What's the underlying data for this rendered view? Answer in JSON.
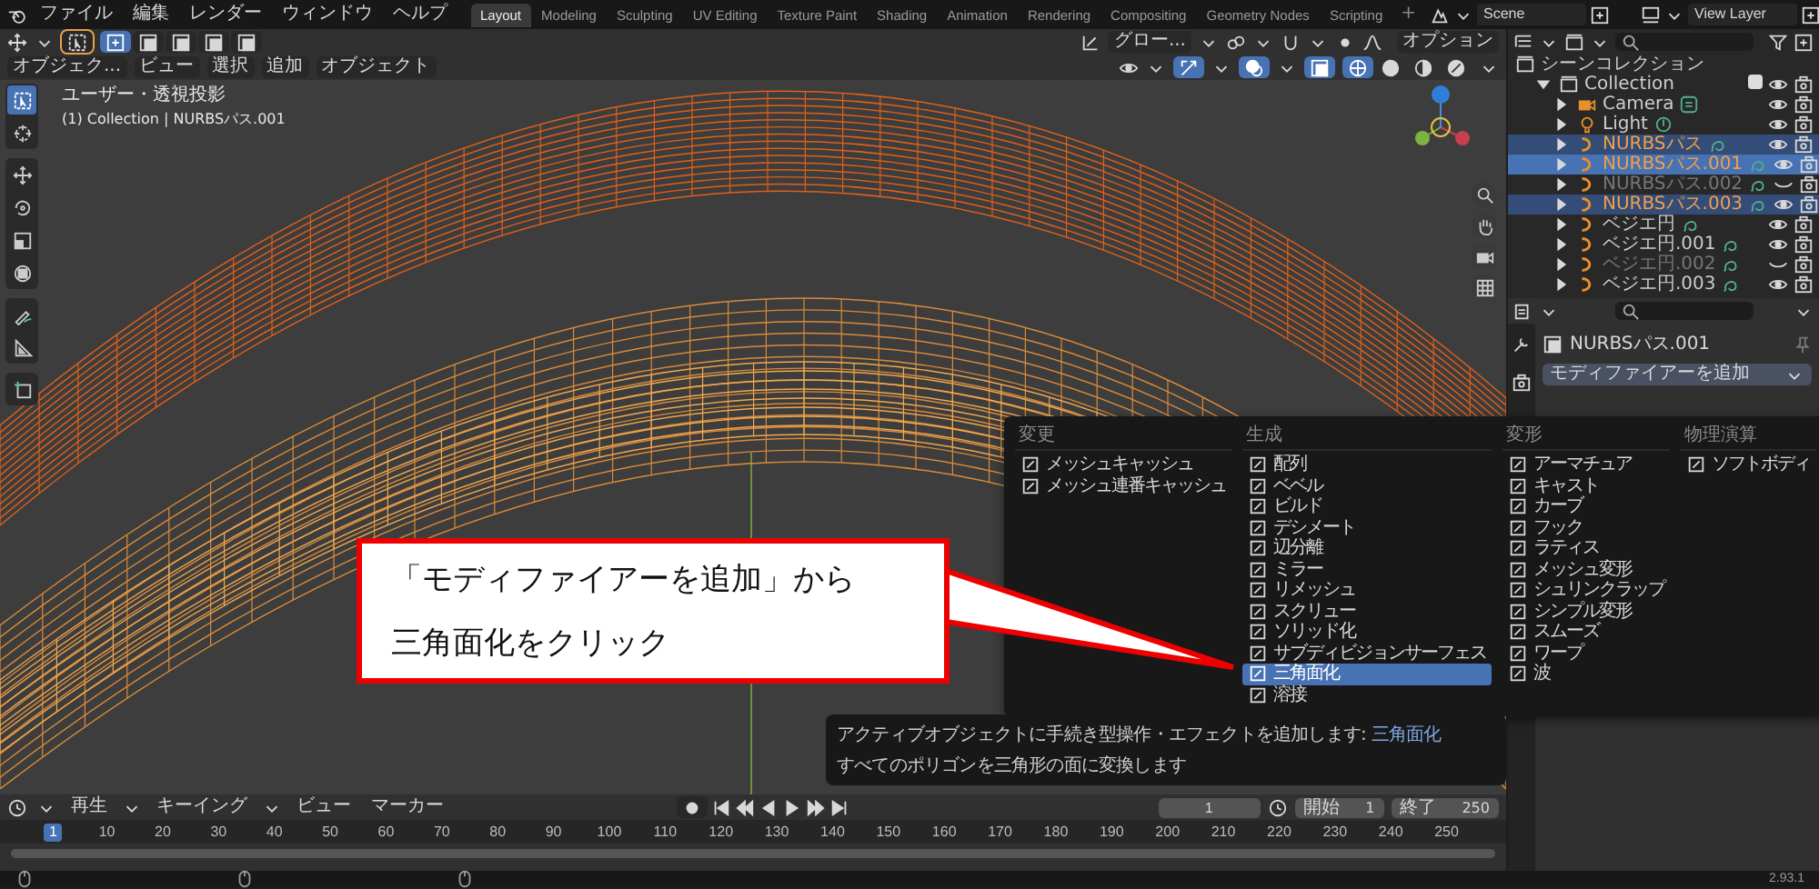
{
  "top_menu": [
    "ファイル",
    "編集",
    "レンダー",
    "ウィンドウ",
    "ヘルプ"
  ],
  "workspace_tabs": [
    {
      "label": "Layout",
      "selected": true
    },
    {
      "label": "Modeling",
      "selected": false
    },
    {
      "label": "Sculpting",
      "selected": false
    },
    {
      "label": "UV Editing",
      "selected": false
    },
    {
      "label": "Texture Paint",
      "selected": false
    },
    {
      "label": "Shading",
      "selected": false
    },
    {
      "label": "Animation",
      "selected": false
    },
    {
      "label": "Rendering",
      "selected": false
    },
    {
      "label": "Compositing",
      "selected": false
    },
    {
      "label": "Geometry Nodes",
      "selected": false
    },
    {
      "label": "Scripting",
      "selected": false
    }
  ],
  "add_workspace": "+",
  "scene": "Scene",
  "view_layer": "View Layer",
  "viewport": {
    "orientation": "グロー...",
    "options": "オプション",
    "mode": "オブジェク...",
    "menus": [
      "ビュー",
      "選択",
      "追加",
      "オブジェクト"
    ],
    "select_modes": [
      {
        "selected": true
      },
      {
        "selected": false
      },
      {
        "selected": false
      },
      {
        "selected": false
      },
      {
        "selected": false
      }
    ],
    "shading_modes": [
      {
        "kind": "wireframe",
        "selected": true
      },
      {
        "kind": "solid",
        "selected": false
      },
      {
        "kind": "material",
        "selected": false
      },
      {
        "kind": "rendered",
        "selected": false
      }
    ],
    "overlay_lines": [
      "ユーザー・透視投影",
      "(1) Collection | NURBSパス.001"
    ],
    "tools": [
      {
        "kind": "select",
        "selected": true
      },
      {
        "kind": "cursor",
        "selected": false
      },
      {
        "kind": "move",
        "selected": false
      },
      {
        "kind": "rotate",
        "selected": false
      },
      {
        "kind": "scale",
        "selected": false
      },
      {
        "kind": "transform",
        "selected": false
      },
      {
        "kind": "annotate",
        "selected": false
      },
      {
        "kind": "measure",
        "selected": false
      },
      {
        "kind": "addcube",
        "selected": false
      }
    ]
  },
  "outliner": {
    "root": "シーンコレクション",
    "children": [
      {
        "name": "Collection",
        "kind": "collection",
        "checked": true,
        "expanded": true,
        "children": [
          {
            "name": "Camera",
            "kind": "camera",
            "expanded": false,
            "selected": false,
            "active": false,
            "hidden": false
          },
          {
            "name": "Light",
            "kind": "light",
            "expanded": false,
            "selected": false,
            "active": false,
            "hidden": false
          },
          {
            "name": "NURBSパス",
            "kind": "curve",
            "expanded": false,
            "selected": true,
            "active": false,
            "hidden": false
          },
          {
            "name": "NURBSパス.001",
            "kind": "curve",
            "expanded": false,
            "selected": true,
            "active": true,
            "hidden": false
          },
          {
            "name": "NURBSパス.002",
            "kind": "curve",
            "expanded": false,
            "selected": false,
            "active": false,
            "hidden": true
          },
          {
            "name": "NURBSパス.003",
            "kind": "curve",
            "expanded": false,
            "selected": true,
            "active": false,
            "hidden": false
          },
          {
            "name": "ベジエ円",
            "kind": "curve",
            "expanded": false,
            "selected": false,
            "active": false,
            "hidden": false
          },
          {
            "name": "ベジエ円.001",
            "kind": "curve",
            "expanded": false,
            "selected": false,
            "active": false,
            "hidden": false
          },
          {
            "name": "ベジエ円.002",
            "kind": "curve",
            "expanded": false,
            "selected": false,
            "active": false,
            "hidden": true
          },
          {
            "name": "ベジエ円.003",
            "kind": "curve",
            "expanded": false,
            "selected": false,
            "active": false,
            "hidden": false
          }
        ]
      }
    ]
  },
  "properties": {
    "object": "NURBSパス.001",
    "add_modifier": "モディファイアーを追加"
  },
  "modifier_menu": {
    "columns": [
      {
        "title": "変更",
        "items": [
          {
            "label": "メッシュキャッシュ",
            "selected": false
          },
          {
            "label": "メッシュ連番キャッシュ",
            "selected": false
          }
        ]
      },
      {
        "title": "生成",
        "items": [
          {
            "label": "配列",
            "selected": false
          },
          {
            "label": "ベベル",
            "selected": false
          },
          {
            "label": "ビルド",
            "selected": false
          },
          {
            "label": "デシメート",
            "selected": false
          },
          {
            "label": "辺分離",
            "selected": false
          },
          {
            "label": "ミラー",
            "selected": false
          },
          {
            "label": "リメッシュ",
            "selected": false
          },
          {
            "label": "スクリュー",
            "selected": false
          },
          {
            "label": "ソリッド化",
            "selected": false
          },
          {
            "label": "サブディビジョンサーフェス",
            "selected": false
          },
          {
            "label": "三角面化",
            "selected": true
          },
          {
            "label": "溶接",
            "selected": false
          }
        ]
      },
      {
        "title": "変形",
        "items": [
          {
            "label": "アーマチュア",
            "selected": false
          },
          {
            "label": "キャスト",
            "selected": false
          },
          {
            "label": "カーブ",
            "selected": false
          },
          {
            "label": "フック",
            "selected": false
          },
          {
            "label": "ラティス",
            "selected": false
          },
          {
            "label": "メッシュ変形",
            "selected": false
          },
          {
            "label": "シュリンクラップ",
            "selected": false
          },
          {
            "label": "シンプル変形",
            "selected": false
          },
          {
            "label": "スムーズ",
            "selected": false
          },
          {
            "label": "ワープ",
            "selected": false
          },
          {
            "label": "波",
            "selected": false
          }
        ]
      },
      {
        "title": "物理演算",
        "items": [
          {
            "label": "ソフトボディ",
            "selected": false
          }
        ]
      }
    ]
  },
  "tooltip": {
    "text": "アクティブオブジェクトに手続き型操作・エフェクトを追加します: ",
    "name": "三角面化",
    "description": "すべてのポリゴンを三角形の面に変換します"
  },
  "callout": {
    "lines": [
      "「モディファイアーを追加」から",
      "三角面化をクリック"
    ]
  },
  "timeline": {
    "menus": [
      "再生",
      "キーイング",
      "ビュー",
      "マーカー"
    ],
    "frame": "1",
    "start_label": "開始",
    "start": "1",
    "end_label": "終了",
    "end": "250",
    "playhead": "1",
    "ticks": [
      "10",
      "20",
      "30",
      "40",
      "50",
      "60",
      "70",
      "80",
      "90",
      "100",
      "110",
      "120",
      "130",
      "140",
      "150",
      "160",
      "170",
      "180",
      "190",
      "200",
      "210",
      "220",
      "230",
      "240",
      "250"
    ]
  },
  "status_bar": {
    "version": "2.93.1"
  }
}
